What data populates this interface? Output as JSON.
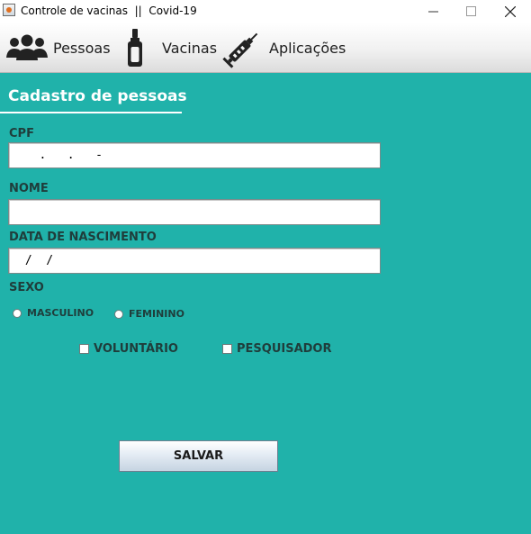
{
  "window": {
    "title": "Controle de vacinas  ||  Covid-19",
    "app_icon": "java-icon",
    "controls": {
      "minimize": "─",
      "maximize": "☐",
      "close": "✕"
    }
  },
  "toolbar": {
    "items": [
      {
        "label": "Pessoas",
        "icon": "people-icon"
      },
      {
        "label": "Vacinas",
        "icon": "vaccine-vial-icon"
      },
      {
        "label": "Aplicações",
        "icon": "syringe-icon"
      }
    ]
  },
  "form": {
    "heading": "Cadastro de pessoas",
    "cpf": {
      "label": "CPF",
      "value": "   .   .   -"
    },
    "nome": {
      "label": "NOME",
      "value": ""
    },
    "nascimento": {
      "label": "DATA DE NASCIMENTO",
      "value": " /  /"
    },
    "sexo": {
      "label": "SEXO",
      "options": [
        "MASCULINO",
        "FEMININO"
      ]
    },
    "voluntario": {
      "label": "VOLUNTÁRIO",
      "checked": false
    },
    "pesquisador": {
      "label": "PESQUISADOR",
      "checked": false
    },
    "save_label": "SALVAR"
  },
  "colors": {
    "background": "#20B2AA",
    "label_text": "#1f3d3b",
    "heading_text": "#ffffff"
  }
}
